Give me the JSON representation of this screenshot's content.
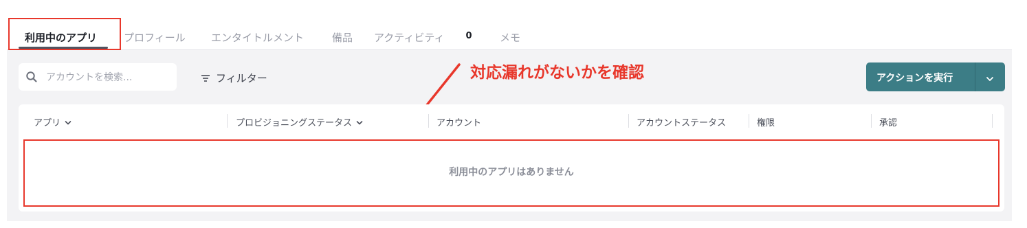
{
  "tabs": [
    {
      "label": "利用中のアプリ",
      "active": true
    },
    {
      "label": "プロフィール",
      "active": false
    },
    {
      "label": "エンタイトルメント",
      "active": false
    },
    {
      "label": "備品",
      "active": false
    },
    {
      "label": "アクティビティ",
      "active": false,
      "badge": "0"
    },
    {
      "label": "メモ",
      "active": false
    }
  ],
  "search": {
    "placeholder": "アカウントを検索...",
    "value": ""
  },
  "filter_label": "フィルター",
  "annotation": "対応漏れがないかを確認",
  "action_button": {
    "label": "アクションを実行"
  },
  "table": {
    "columns": [
      "アプリ",
      "プロビジョニングステータス",
      "アカウント",
      "アカウントステータス",
      "権限",
      "承認"
    ],
    "empty_message": "利用中のアプリはありません"
  },
  "colors": {
    "accent": "#3c7d86",
    "annotation_red": "#e8372b"
  }
}
